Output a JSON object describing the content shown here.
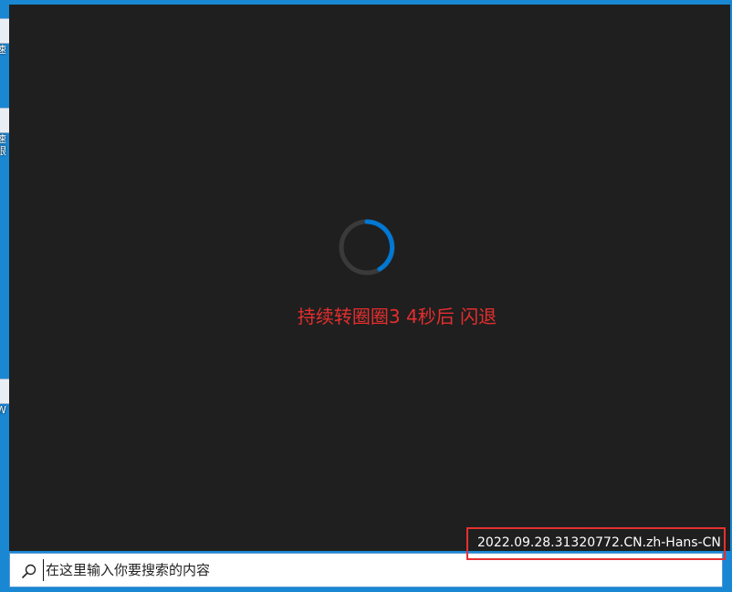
{
  "desktop": {
    "icons": [
      {
        "name": "desktop-icon-1",
        "caption": "速"
      },
      {
        "name": "desktop-icon-2",
        "caption": "速\n眼"
      },
      {
        "name": "desktop-icon-3",
        "caption": "W"
      }
    ]
  },
  "app": {
    "status_message": "持续转圈圈3 4秒后 闪退",
    "version": "2022.09.28.31320772.CN.zh-Hans-CN",
    "spinner_icon": "loading-spinner-icon"
  },
  "taskbar": {
    "search_placeholder": "在这里输入你要搜索的内容",
    "search_icon": "search-icon"
  },
  "colors": {
    "desktop_bg": "#1a87d3",
    "window_bg": "#1f1f1f",
    "accent": "#0078d4",
    "annotation_red": "#e53030"
  }
}
